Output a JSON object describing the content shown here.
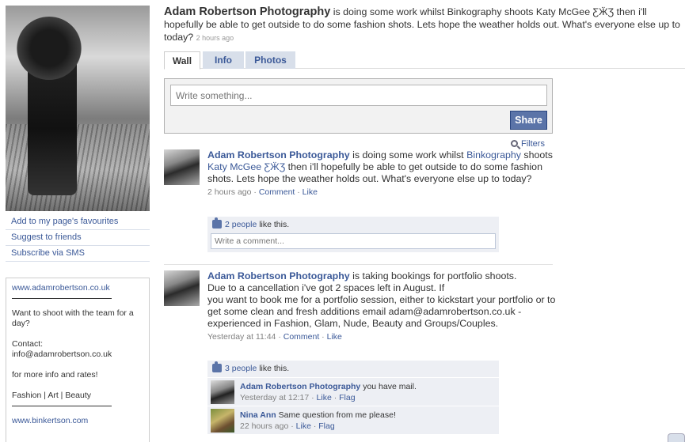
{
  "page": {
    "name": "Adam Robertson Photography",
    "status_text": "is doing some work whilst Binkography shoots Katy McGee ƸӜƷ then i'll hopefully be able to get outside to do some fashion shots. Lets hope the weather holds out. What's everyone else up to today?",
    "status_time": "2 hours ago"
  },
  "sidebar": {
    "links": [
      "Add to my page's favourites",
      "Suggest to friends",
      "Subscribe via SMS"
    ],
    "info": {
      "website": "www.adamrobertson.co.uk",
      "blurb": "Want to shoot with the team for a day?",
      "contact_label": "Contact:",
      "contact_email": "info@adamrobertson.co.uk",
      "more_info": "for more info and rates!",
      "genres": "Fashion | Art | Beauty",
      "website2": "www.binkertson.com"
    }
  },
  "tabs": [
    "Wall",
    "Info",
    "Photos"
  ],
  "composer": {
    "placeholder": "Write something...",
    "share_label": "Share"
  },
  "filters_label": "Filters",
  "stories": [
    {
      "author": "Adam Robertson Photography",
      "text_1": "is doing some work whilst",
      "mention_1": "Binkography",
      "text_2": "shoots",
      "mention_2": "Katy McGee ƸӜƷ",
      "text_3": "then i'll hopefully be able to get outside to do some fashion shots. Lets hope the weather holds out. What's everyone else up to today?",
      "time": "2 hours ago",
      "comment_label": "Comment",
      "like_label": "Like",
      "likes_count": "2 people",
      "likes_suffix": "like this.",
      "comment_placeholder": "Write a comment..."
    },
    {
      "author": "Adam Robertson Photography",
      "text_1": "is taking bookings for portfolio shoots.",
      "text_2": "Due to a cancellation i've got 2 spaces left in August. If",
      "text_3": "you want to book me for a portfolio session, either to kickstart your portfolio or to get some clean and fresh additions email adam@adamrobertson.co.uk - experienced in Fashion, Glam, Nude, Beauty and Groups/Couples.",
      "time": "Yesterday at 11:44",
      "comment_label": "Comment",
      "like_label": "Like",
      "likes_count": "3 people",
      "likes_suffix": "like this.",
      "comments": [
        {
          "author": "Adam Robertson Photography",
          "text": "you have mail.",
          "time": "Yesterday at 12:17",
          "like_label": "Like",
          "flag_label": "Flag"
        },
        {
          "author": "Nina Ann",
          "text": "Same question from me please!",
          "time": "22 hours ago",
          "like_label": "Like",
          "flag_label": "Flag"
        }
      ]
    }
  ]
}
